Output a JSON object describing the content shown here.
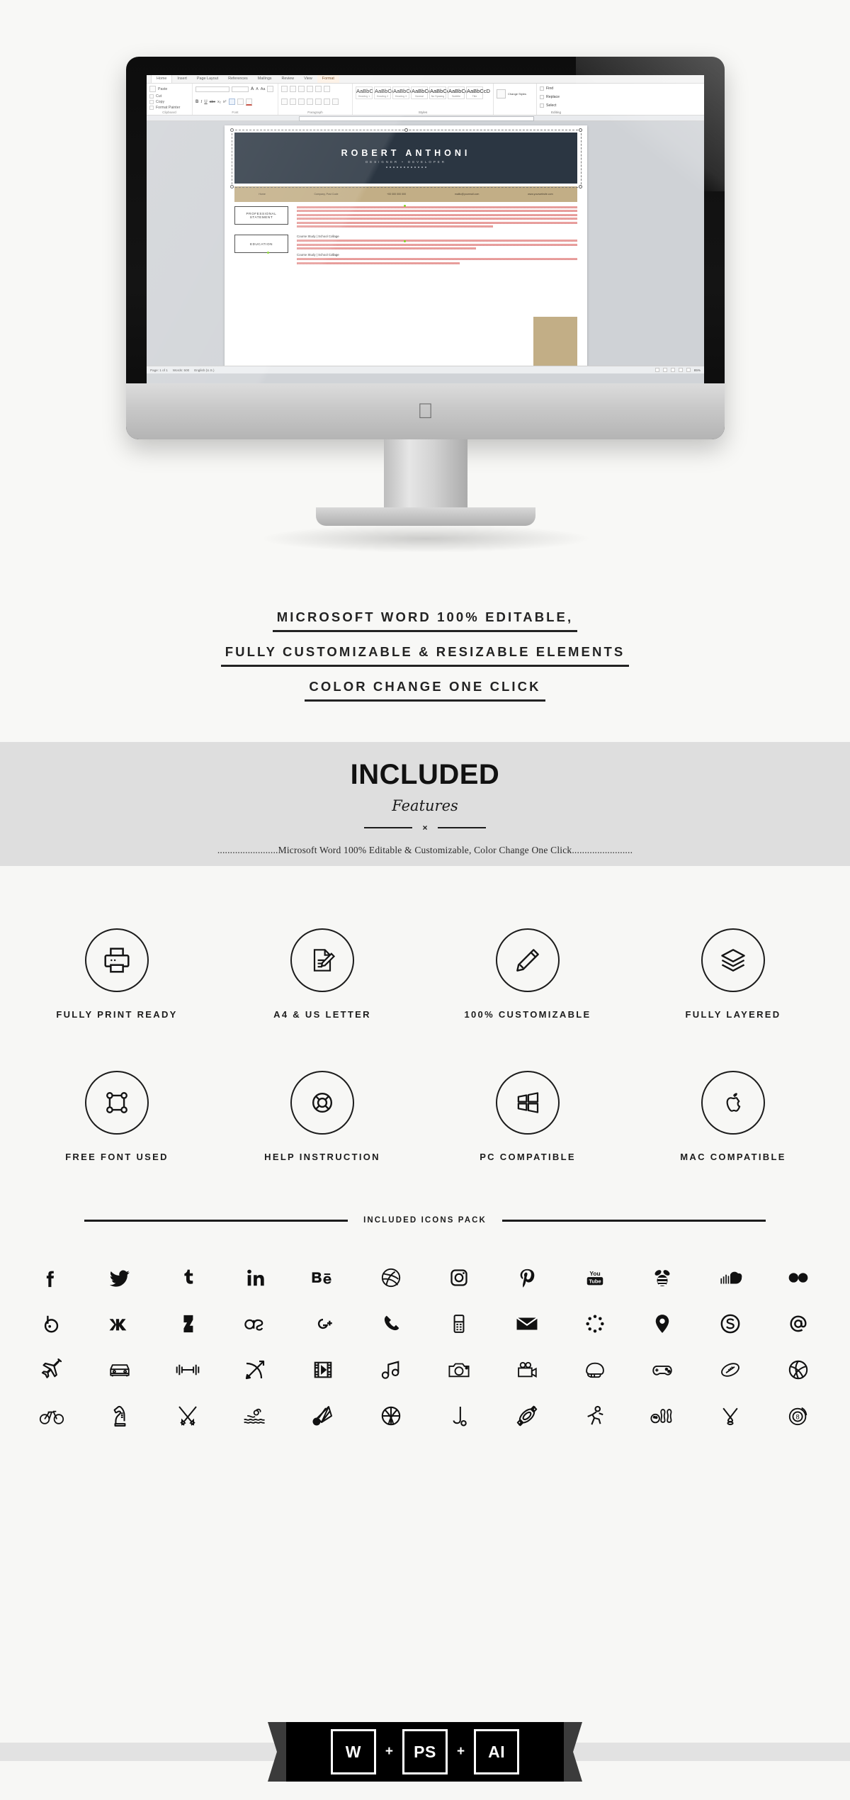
{
  "hero": {
    "device": "imac",
    "apple_logo": "",
    "word": {
      "tabs": [
        "Home",
        "Insert",
        "Page Layout",
        "References",
        "Mailings",
        "Review",
        "View",
        "Format"
      ],
      "active_tab": "Home",
      "clipboard_items": [
        "Paste",
        "Cut",
        "Copy",
        "Format Painter"
      ],
      "groups": [
        "Clipboard",
        "Font",
        "Paragraph",
        "Styles",
        "Editing"
      ],
      "style_gallery": [
        {
          "preview": "AaBbC",
          "name": "Heading 1"
        },
        {
          "preview": "AaBbCcD",
          "name": "Heading 2"
        },
        {
          "preview": "AaBbCcD",
          "name": "Heading 3"
        },
        {
          "preview": "AaBbCcDc",
          "name": "Normal"
        },
        {
          "preview": "AaBbCcDc",
          "name": "No Spacing"
        },
        {
          "preview": "AaBbCcD",
          "name": "Subtitle"
        },
        {
          "preview": "AaBbCcD",
          "name": "Title"
        }
      ],
      "style_pane_labels": [
        "Change Styles"
      ],
      "editing_labels": [
        "Find",
        "Replace",
        "Select"
      ],
      "status": {
        "page": "Page: 1 of 1",
        "words": "Words: 500",
        "language": "English (U.S.)",
        "zoom": "85%"
      }
    },
    "cv": {
      "name": "ROBERT ANTHONI",
      "subtitle": "DESIGNER  •  DEVELOPER",
      "contact_bar": [
        "Home",
        "Company, Post Code",
        "+00 000 000 000",
        "mailto@yourmail.com",
        "www.yourwebsite.com"
      ],
      "sections": [
        {
          "tag": "PROFESSIONAL\nSTATEMENT",
          "entries": [
            ""
          ]
        },
        {
          "tag": "EDUCATION",
          "entries": [
            "Course Study | School Collage",
            "Course Study | School Collage"
          ]
        }
      ]
    }
  },
  "caption": {
    "lines": [
      "MICROSOFT WORD 100% EDITABLE,",
      "FULLY CUSTOMIZABLE & RESIZABLE ELEMENTS",
      "COLOR CHANGE ONE CLICK"
    ]
  },
  "included": {
    "title": "INCLUDED",
    "script": "Features",
    "divider_mark": "×",
    "note": "........................Microsoft Word 100% Editable & Customizable, Color Change One Click........................"
  },
  "features": {
    "row1": [
      {
        "icon": "printer-icon",
        "label": "FULLY PRINT READY"
      },
      {
        "icon": "document-edit-icon",
        "label": "A4 & US LETTER"
      },
      {
        "icon": "pencil-icon",
        "label": "100% CUSTOMIZABLE"
      },
      {
        "icon": "layers-icon",
        "label": "FULLY LAYERED"
      }
    ],
    "row2": [
      {
        "icon": "anchor-points-icon",
        "label": "FREE FONT USED"
      },
      {
        "icon": "lifebuoy-icon",
        "label": "HELP INSTRUCTION"
      },
      {
        "icon": "windows-icon",
        "label": "PC COMPATIBLE"
      },
      {
        "icon": "apple-icon",
        "label": "MAC COMPATIBLE"
      }
    ]
  },
  "icons_pack": {
    "divider_label": "INCLUDED ICONS PACK",
    "rows": [
      [
        "facebook-icon",
        "twitter-icon",
        "tumblr-icon",
        "linkedin-icon",
        "behance-icon",
        "dribbble-icon",
        "instagram-icon",
        "pinterest-icon",
        "youtube-icon",
        "swarm-bee-icon",
        "soundcloud-icon",
        "flickr-icon"
      ],
      [
        "blogger-icon",
        "vk-icon",
        "deviantart-icon",
        "lastfm-icon",
        "google-plus-icon",
        "phone-icon",
        "mobile-phone-icon",
        "envelope-icon",
        "dots-circle-icon",
        "location-pin-icon",
        "skype-icon",
        "at-sign-icon"
      ],
      [
        "airplane-icon",
        "car-icon",
        "dumbbell-icon",
        "archery-icon",
        "film-icon",
        "music-note-icon",
        "camera-icon",
        "video-camera-icon",
        "football-helmet-icon",
        "gamepad-icon",
        "american-football-icon",
        "volleyball-icon"
      ],
      [
        "bicycle-icon",
        "chess-knight-icon",
        "fencing-icon",
        "swimming-icon",
        "badminton-icon",
        "basketball-icon",
        "golf-icon",
        "kayak-icon",
        "running-icon",
        "bowling-icon",
        "hockey-icon",
        "billiards-eight-ball-icon"
      ]
    ]
  },
  "footer": {
    "boxes": [
      "W",
      "PS",
      "AI"
    ],
    "separators": [
      "+",
      "+"
    ]
  },
  "colors": {
    "page_bg": "#f7f7f5",
    "included_bg": "#dedede",
    "ink": "#1c1c1c",
    "cv_header": "#2b3642",
    "cv_accent": "#c2ae86",
    "badge_bg": "#000000"
  }
}
